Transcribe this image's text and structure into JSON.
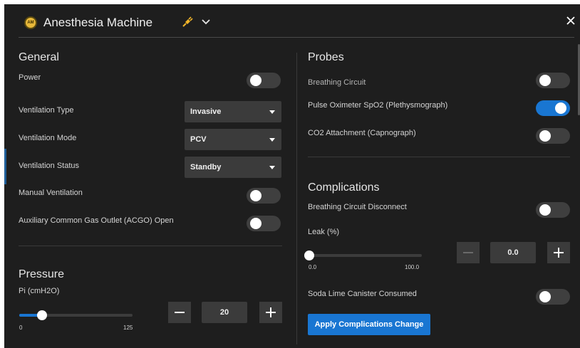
{
  "header": {
    "logo_text": "AM",
    "title": "Anesthesia Machine"
  },
  "general": {
    "title": "General",
    "power_label": "Power",
    "power_on": false,
    "ventilation_type_label": "Ventilation Type",
    "ventilation_type_value": "Invasive",
    "ventilation_mode_label": "Ventilation Mode",
    "ventilation_mode_value": "PCV",
    "ventilation_status_label": "Ventilation Status",
    "ventilation_status_value": "Standby",
    "manual_ventilation_label": "Manual Ventilation",
    "manual_ventilation_on": false,
    "acgo_label": "Auxiliary Common Gas Outlet (ACGO) Open",
    "acgo_on": false
  },
  "pressure": {
    "title": "Pressure",
    "pi_label": "Pi (cmH2O)",
    "pi_min": "0",
    "pi_max": "125",
    "pi_value": "20",
    "pi_fraction": 0.2
  },
  "probes": {
    "title": "Probes",
    "breathing_circuit_label": "Breathing Circuit",
    "breathing_circuit_on": false,
    "pulse_oximeter_label": "Pulse Oximeter SpO2 (Plethysmograph)",
    "pulse_oximeter_on": true,
    "co2_label": "CO2 Attachment (Capnograph)",
    "co2_on": false
  },
  "complications": {
    "title": "Complications",
    "disconnect_label": "Breathing Circuit Disconnect",
    "disconnect_on": false,
    "leak_label": "Leak (%)",
    "leak_min": "0.0",
    "leak_max": "100.0",
    "leak_value": "0.0",
    "leak_fraction": 0.0,
    "soda_lime_label": "Soda Lime Canister Consumed",
    "soda_lime_on": false,
    "apply_label": "Apply Complications Change"
  },
  "colors": {
    "accent": "#1976d2",
    "panel_bg": "#1e1e1e",
    "logo": "#e8b83a",
    "plug_icon": "#f0b429"
  }
}
